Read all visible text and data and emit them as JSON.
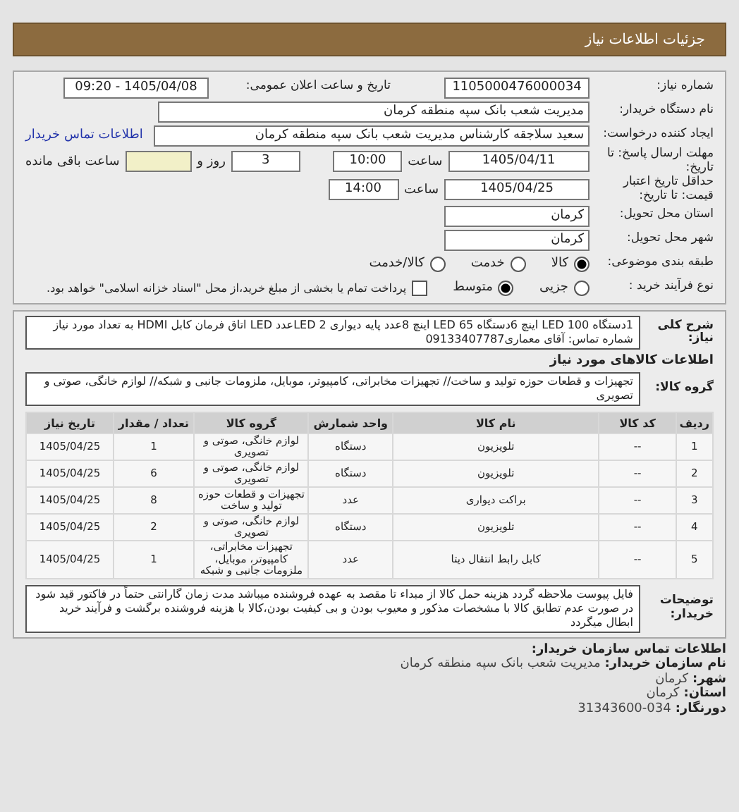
{
  "header": {
    "title": "جزئیات اطلاعات نیاز"
  },
  "details": [
    {
      "kind": "pair",
      "label": "شماره نیاز:",
      "value": "1105000476000034",
      "label2": "تاریخ و ساعت اعلان عمومی:",
      "value2": "1405/04/08 - 09:20"
    },
    {
      "kind": "wide",
      "label": "نام دستگاه خریدار:",
      "value": "مدیریت شعب بانک سپه منطقه کرمان"
    },
    {
      "kind": "wide",
      "label": "ایجاد کننده درخواست:",
      "value": "سعید سلاجقه کارشناس مدیریت شعب بانک سپه منطقه کرمان",
      "link": "اطلاعات تماس خریدار"
    },
    {
      "kind": "deadline",
      "label": "مهلت ارسال پاسخ: تا تاریخ:",
      "date": "1405/04/11",
      "time_label": "ساعت",
      "time": "10:00",
      "days": "3",
      "days_label": "روز و",
      "remaining_label": "ساعت باقی مانده"
    },
    {
      "kind": "deadline",
      "label": "حداقل تاریخ اعتبار قیمت: تا تاریخ:",
      "date": "1405/04/25",
      "time_label": "ساعت",
      "time": "14:00"
    },
    {
      "kind": "single",
      "label": "استان محل تحویل:",
      "value": "کرمان"
    },
    {
      "kind": "single",
      "label": "شهر محل تحویل:",
      "value": "کرمان"
    },
    {
      "kind": "radios",
      "label": "طبقه بندی موضوعی:",
      "options": [
        {
          "label": "کالا",
          "selected": true
        },
        {
          "label": "خدمت",
          "selected": false
        },
        {
          "label": "کالا/خدمت",
          "selected": false
        }
      ]
    },
    {
      "kind": "radios",
      "label": "نوع فرآیند خرید :",
      "options": [
        {
          "label": "جزیی",
          "selected": false
        },
        {
          "label": "متوسط",
          "selected": true
        }
      ],
      "checkbox": {
        "label": "پرداخت تمام یا بخشی از مبلغ خرید،از محل \"اسناد خزانه اسلامی\" خواهد بود.",
        "checked": false
      }
    }
  ],
  "summary": {
    "label": "شرح کلی نیاز:",
    "text": "1دستگاه 100 LED اینچ 6دستگاه 65 LED اینچ 8عدد پایه دیواری 2 LEDعدد LED اتاق فرمان کابل HDMI به تعداد مورد نیاز شماره تماس: آقای معماری09133407787"
  },
  "goods_heading": "اطلاعات کالاهای مورد نیاز",
  "goods_group": {
    "label": "گروه کالا:",
    "text": "تجهیزات و قطعات حوزه تولید و ساخت// تجهیزات مخابراتی، کامپیوتر، موبایل، ملزومات جانبی و شبکه// لوازم خانگی، صوتی و تصویری"
  },
  "table": {
    "columns": [
      "ردیف",
      "کد کالا",
      "نام کالا",
      "واحد شمارش",
      "گروه کالا",
      "تعداد / مقدار",
      "تاریخ نیاز"
    ],
    "rows": [
      [
        "1",
        "--",
        "تلویزیون",
        "دستگاه",
        "لوازم خانگی، صوتی و تصویری",
        "1",
        "1405/04/25"
      ],
      [
        "2",
        "--",
        "تلویزیون",
        "دستگاه",
        "لوازم خانگی، صوتی و تصویری",
        "6",
        "1405/04/25"
      ],
      [
        "3",
        "--",
        "براکت دیواری",
        "عدد",
        "تجهیزات و قطعات حوزه تولید و ساخت",
        "8",
        "1405/04/25"
      ],
      [
        "4",
        "--",
        "تلویزیون",
        "دستگاه",
        "لوازم خانگی، صوتی و تصویری",
        "2",
        "1405/04/25"
      ],
      [
        "5",
        "--",
        "کابل رابط انتقال دیتا",
        "عدد",
        "تجهیزات مخابراتی، کامپیوتر، موبایل، ملزومات جانبی و شبکه",
        "1",
        "1405/04/25"
      ]
    ]
  },
  "notes": {
    "label": "توضیحات خریدار:",
    "text": "فایل پیوست ملاحظه گردد هزینه حمل کالا از مبداء تا مقصد به عهده فروشنده میباشد مدت زمان گارانتی حتماً در فاکتور قید شود در صورت عدم تطابق کالا با مشخصات مذکور و معیوب بودن و بی کیفیت بودن،کالا با هزینه فروشنده برگشت و فرآیند خرید ابطال میگردد"
  },
  "contact": {
    "heading": "اطلاعات تماس سازمان خریدار:",
    "lines": [
      {
        "label": "نام سازمان خریدار:",
        "value": "مدیریت شعب بانک سپه منطقه کرمان"
      },
      {
        "label": "شهر:",
        "value": "کرمان"
      },
      {
        "label": "استان:",
        "value": "کرمان"
      },
      {
        "label": "دورنگار:",
        "value": "31343600-034"
      }
    ]
  }
}
